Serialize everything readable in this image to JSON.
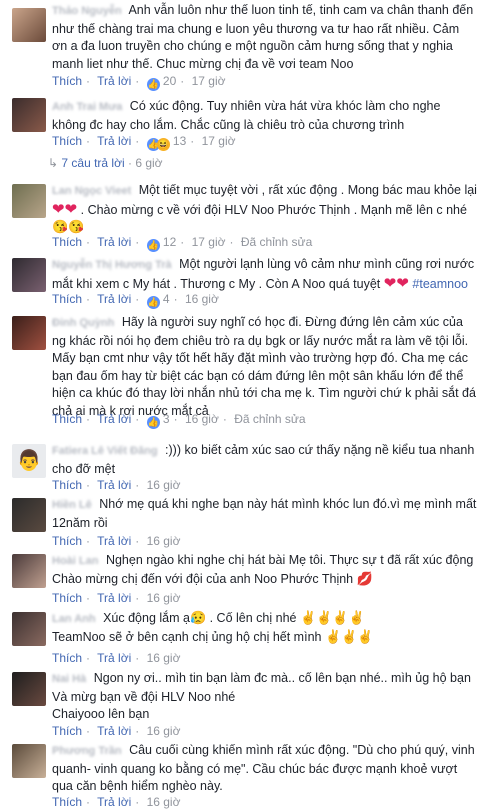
{
  "labels": {
    "like": "Thích",
    "reply": "Trả lời",
    "edited": "Đã chỉnh sửa",
    "dot": "·"
  },
  "comments": [
    {
      "name": "Thảo Nguyễn",
      "text": "Anh vẫn luôn như thế luon tinh tế, tinh cam va chân thanh đến như thế chàng trai ma chung e luon yêu thương va tư hao rất nhiều. Cảm ơn a đa luon truyền cho chúng e một nguồn cảm hưng sống that y nghia manh liet như thế. Chuc mừng chị đa về vơi team Noo",
      "count": "20",
      "time": "17 giờ"
    },
    {
      "name": "Anh Trai Mưa",
      "text": "Có xúc động. Tuy nhiên vừa hát vừa khóc làm cho nghe không đc hay cho lắm. Chắc cũng là chiêu trò của chương trình",
      "count": "13",
      "time": "17 giờ"
    },
    {
      "name": "Lan Ngọc Vieet",
      "text": "Một tiết mục tuyệt vời , rất xúc động . Mong bác mau khỏe lại",
      "text2": ". Chào mừng c về với đội HLV Noo Phước Thịnh . Mạnh mẽ lên c nhé",
      "count": "12",
      "time": "17 giờ"
    },
    {
      "name": "Nguyễn Thị Hương Trà",
      "text": "Một người lạnh lùng vô cảm như mình cũng rơi nước mắt khi xem c My hát . Thương c My . Còn A Noo quá tuyệt",
      "hashtag": "#teamnoo",
      "count": "4",
      "time": "16 giờ"
    },
    {
      "name": "Đinh Quỳnh",
      "text": "Hãy là người suy nghĩ có học đi. Đừng đứng lên cảm xúc của ng khác rồi nói họ đem chiêu trò ra dụ bgk or lấy nước mắt ra làm vẽ tội lỗi. Mấy bạn cmt như vậy tốt hết hãy đặt mình vào trường hợp đó. Cha mẹ các bạn đau ốm hay từ biệt các bạn có dám đứng lên một sân khấu lớn để thể hiện ca khúc đó thay lời nhắn nhủ tới cha mẹ k. Tìm người chứ k phải sắt đá chả ai mà k rơi nước mắt cả",
      "count": "3",
      "time": "16 giờ"
    },
    {
      "name": "Fatiera Lê Viết Đăng",
      "text": ":))) ko biết cảm xúc sao cứ thấy nặng nề kiểu tua nhanh cho đỡ mệt",
      "count": "",
      "time": "16 giờ"
    },
    {
      "name": "Hiền Lê",
      "text": "Nhớ mẹ quá khi nghe bạn này hát mình khóc lun đó.vì mẹ mình mất 12năm rồi",
      "count": "",
      "time": "16 giờ"
    },
    {
      "name": "Hoài Lan",
      "text": "Nghẹn ngào khi nghe chị hát bài Mẹ tôi. Thực sự t đã rất xúc động Chào mừng chị đến với đội của anh Noo Phước Thịnh",
      "count": "",
      "time": "16 giờ"
    },
    {
      "name": "Lan Anh",
      "text": "Xúc động lắm ạ",
      "text2": ". Cố lên chị nhé",
      "text3": "TeamNoo sẽ ở bên cạnh chị ủng hộ chị hết mình",
      "count": "",
      "time": "16 giờ"
    },
    {
      "name": "Nai Hà",
      "text": "Ngon ny ơi.. mìh tin bạn làm đc mà.. cố lên bạn nhé.. mìh ủg hộ bạn Và mừg bạn về đội HLV Noo nhé",
      "text2": "Chaiyooo lên bạn",
      "count": "",
      "time": "16 giờ"
    },
    {
      "name": "Phương Trần",
      "text": "Câu cuối cùng khiến mình rất xúc động. \"Dù cho phú quý, vinh quanh- vinh quang ko bằng có mẹ\". Cầu chúc bác được mạnh khoẻ vượt qua căn bệnh hiểm nghèo này.",
      "count": "",
      "time": "16 giờ"
    }
  ],
  "replies": {
    "label": "7 câu trả lời",
    "time": "6 giờ"
  },
  "colors": {
    "link": "#4267b2",
    "meta": "#90949c",
    "text": "#1d2129"
  }
}
